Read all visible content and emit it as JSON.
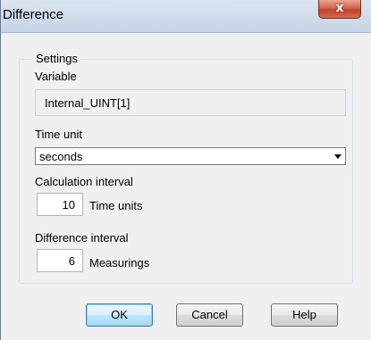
{
  "window": {
    "title": "Difference",
    "close_glyph": "x"
  },
  "settings": {
    "legend": "Settings",
    "variable_label": "Variable",
    "variable_value": "Internal_UINT[1]",
    "time_unit_label": "Time unit",
    "time_unit_selected": "seconds",
    "calc_interval_label": "Calculation interval",
    "calc_interval_value": "10",
    "calc_interval_unit": "Time units",
    "diff_interval_label": "Difference interval",
    "diff_interval_value": "6",
    "diff_interval_unit": "Measurings"
  },
  "buttons": {
    "ok": "OK",
    "cancel": "Cancel",
    "help": "Help"
  },
  "colors": {
    "close_button": "#c7472c",
    "default_button_border": "#3c7fb1"
  }
}
